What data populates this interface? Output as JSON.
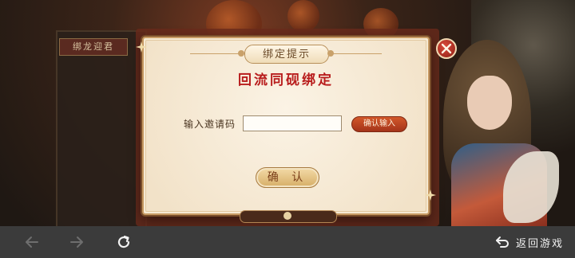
{
  "scene": {
    "bookcase_tag": "绑龙迎君"
  },
  "modal": {
    "title": "绑定提示",
    "heading": "回流同砚绑定",
    "code_label": "输入邀请码",
    "code_value": "",
    "code_placeholder": "",
    "confirm_input_label": "确认输入",
    "confirm_label": "确 认"
  },
  "nav_bar": {
    "back_to_game_label": "返回游戏"
  },
  "colors": {
    "heading_red": "#b81c1c",
    "nav_bg": "#3b3b3b",
    "modal_bg": "#f6e9d3",
    "accent_orange": "#c0481f"
  },
  "icons": {
    "back": "arrow-left-icon",
    "forward": "arrow-right-icon",
    "reload": "reload-icon",
    "return": "return-arrow-icon",
    "close": "close-icon"
  }
}
